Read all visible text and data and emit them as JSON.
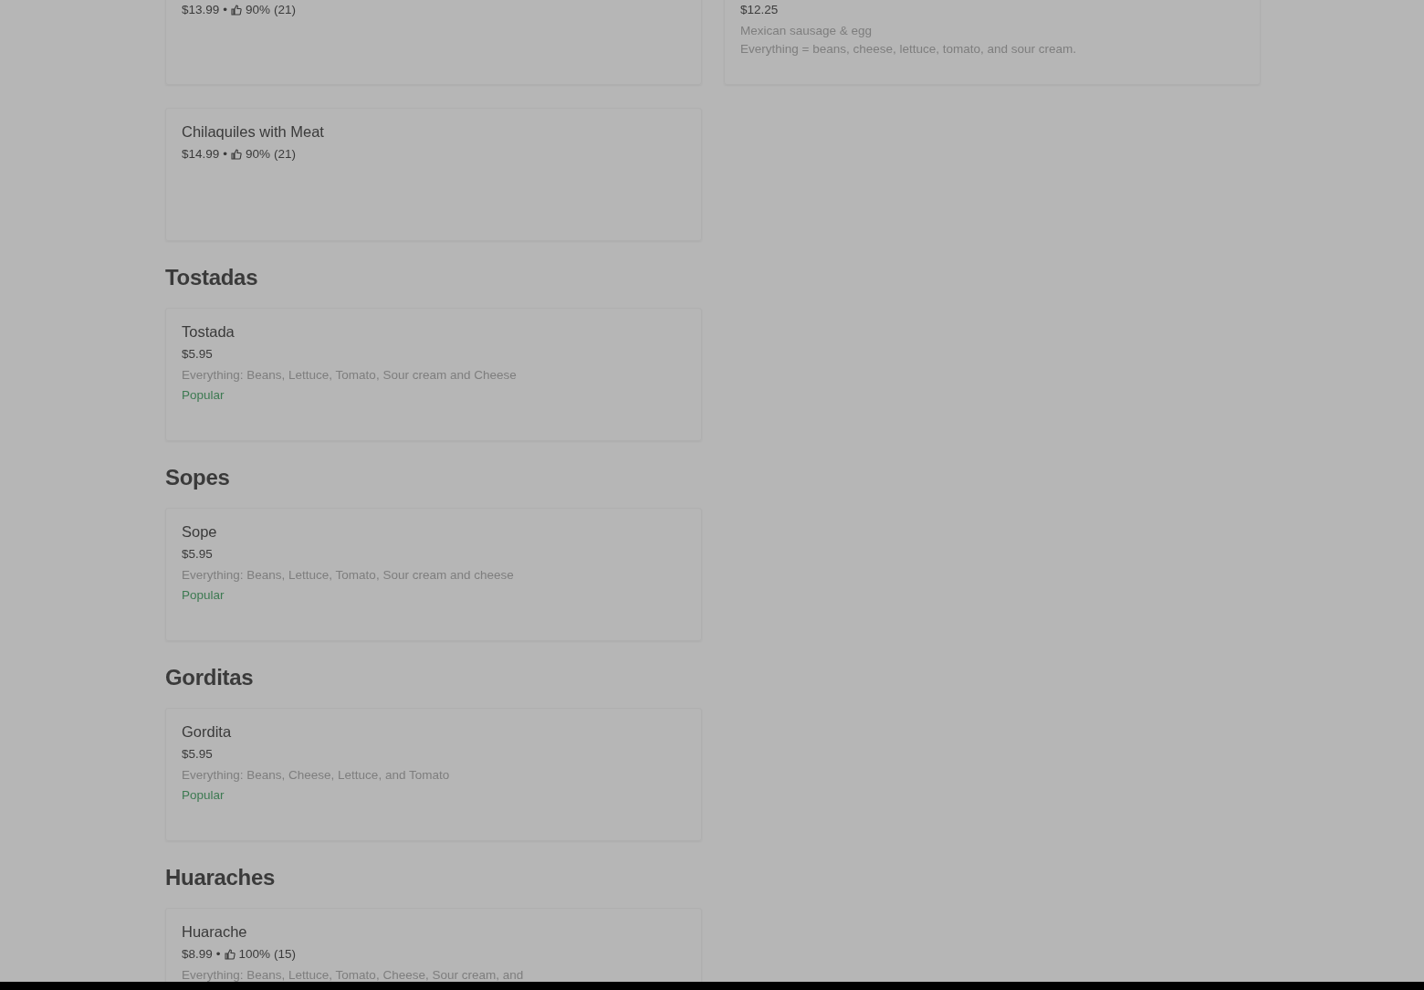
{
  "sections": [
    {
      "rows": [
        [
          {
            "price": "$13.99",
            "rating": {
              "separator": "•",
              "percent": "90%",
              "count": "(21)"
            }
          },
          {
            "price": "$12.25",
            "descriptions": [
              "Mexican sausage & egg",
              "Everything = beans, cheese, lettuce, tomato, and sour cream."
            ]
          }
        ],
        [
          {
            "name": "Chilaquiles with Meat",
            "price": "$14.99",
            "rating": {
              "separator": "•",
              "percent": "90%",
              "count": "(21)"
            }
          }
        ]
      ]
    },
    {
      "heading": "Tostadas",
      "rows": [
        [
          {
            "name": "Tostada",
            "price": "$5.95",
            "descriptions": [
              "Everything: Beans, Lettuce, Tomato, Sour cream and Cheese"
            ],
            "badge": "Popular"
          }
        ]
      ]
    },
    {
      "heading": "Sopes",
      "rows": [
        [
          {
            "name": "Sope",
            "price": "$5.95",
            "descriptions": [
              "Everything: Beans, Lettuce, Tomato, Sour cream and cheese"
            ],
            "badge": "Popular"
          }
        ]
      ]
    },
    {
      "heading": "Gorditas",
      "rows": [
        [
          {
            "name": "Gordita",
            "price": "$5.95",
            "descriptions": [
              "Everything: Beans, Cheese, Lettuce, and Tomato"
            ],
            "badge": "Popular"
          }
        ]
      ]
    },
    {
      "heading": "Huaraches",
      "rows": [
        [
          {
            "name": "Huarache",
            "price": "$8.99",
            "rating": {
              "separator": "•",
              "percent": "100%",
              "count": "(15)"
            },
            "descriptions": [
              "Everything: Beans, Lettuce, Tomato, Cheese, Sour cream, and"
            ]
          }
        ]
      ]
    }
  ]
}
